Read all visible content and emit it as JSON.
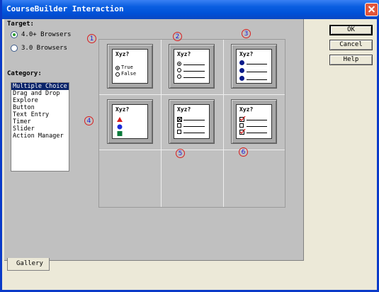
{
  "window": {
    "title": "CourseBuilder Interaction",
    "close_icon": "close-icon"
  },
  "target": {
    "label": "Target:",
    "options": [
      {
        "label": "4.0+ Browsers",
        "selected": true
      },
      {
        "label": "3.0 Browsers",
        "selected": false
      }
    ]
  },
  "category": {
    "label": "Category:",
    "items": [
      "Multiple Choice",
      "Drag and Drop",
      "Explore",
      "Button",
      "Text Entry",
      "Timer",
      "Slider",
      "Action Manager"
    ],
    "selected_index": 0
  },
  "gallery": {
    "tab_label": "Gallery",
    "tiles": [
      {
        "number": "1",
        "title": "Xyz?",
        "variant": "true-false",
        "options": [
          "True",
          "False"
        ]
      },
      {
        "number": "2",
        "title": "Xyz?",
        "variant": "radio-lines"
      },
      {
        "number": "3",
        "title": "Xyz?",
        "variant": "dot-lines"
      },
      {
        "number": "4",
        "title": "Xyz?",
        "variant": "shapes"
      },
      {
        "number": "5",
        "title": "Xyz?",
        "variant": "checkbox-lines"
      },
      {
        "number": "6",
        "title": "Xyz?",
        "variant": "checked-lines"
      }
    ]
  },
  "buttons": {
    "ok": "OK",
    "cancel": "Cancel",
    "help": "Help"
  },
  "colors": {
    "title_bar": "#0a5ee0",
    "panel": "#c0c0c0",
    "selection": "#0a246a",
    "annotation_circle": "#d81e1e",
    "annotation_text": "#1a1ad8"
  }
}
